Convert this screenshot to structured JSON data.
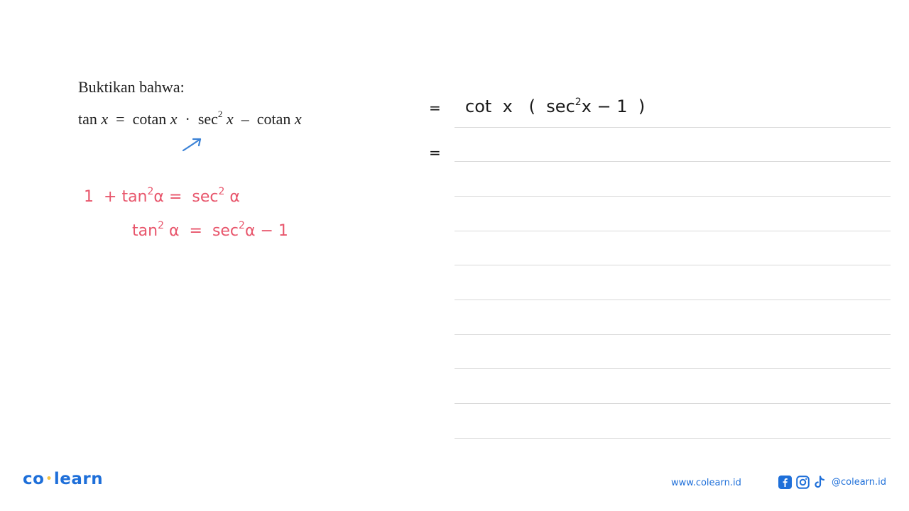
{
  "problem": {
    "title": "Buktikan bahwa:",
    "equation": {
      "lhs_fn": "tan",
      "var": "x",
      "equals": "=",
      "term1_fn": "cotan",
      "dot": "·",
      "term2_fn": "sec",
      "exp": "2",
      "minus": "–",
      "term3_fn": "cotan"
    }
  },
  "annotations": {
    "arrow_color": "#3b82d6",
    "pink_color": "#e8566c",
    "identity_line1": {
      "one": "1",
      "plus": "+",
      "tan": "tan",
      "exp": "2",
      "alpha": "α",
      "eq": "=",
      "sec": "sec",
      "exp2": "2",
      "alpha2": "α"
    },
    "identity_line2": {
      "tan": "tan",
      "exp": "2",
      "alpha": "α",
      "eq": "=",
      "sec": "sec",
      "exp2": "2",
      "alpha2": "α",
      "rest": "− 1"
    }
  },
  "work": {
    "step1": {
      "eq": "=",
      "cot": "cot",
      "x": "x",
      "open": "(",
      "sec": "sec",
      "exp": "2",
      "x2": "x",
      "rest": "− 1",
      "close": ")"
    },
    "step2": {
      "eq": "="
    }
  },
  "footer": {
    "logo_left": "co",
    "logo_dot": "•",
    "logo_right": "learn",
    "url": "www.colearn.id",
    "social_icons": [
      "facebook-icon",
      "instagram-icon",
      "tiktok-icon"
    ],
    "handle": "@colearn.id",
    "brand_color": "#1e6fd9"
  }
}
